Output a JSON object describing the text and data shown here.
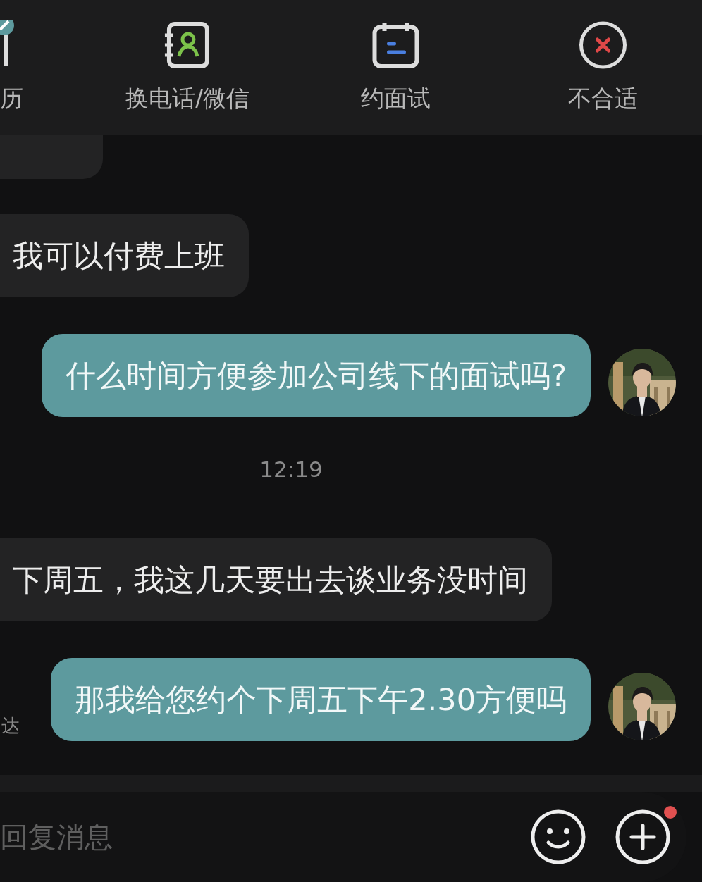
{
  "toolbar": [
    {
      "label": "历",
      "kind": "resume"
    },
    {
      "label": "换电话/微信",
      "kind": "contact"
    },
    {
      "label": "约面试",
      "kind": "interview"
    },
    {
      "label": "不合适",
      "kind": "reject"
    }
  ],
  "messages": [
    {
      "kind": "fragment"
    },
    {
      "kind": "received",
      "text": "我可以付费上班"
    },
    {
      "kind": "sent",
      "text": "什么时间方便参加公司线下的面试吗?"
    },
    {
      "kind": "time",
      "text": "12:19"
    },
    {
      "kind": "received",
      "text": "下周五，我这几天要出去谈业务没时间"
    },
    {
      "kind": "sent",
      "text": "那我给您约个下周五下午2.30方便吗",
      "status": "达"
    }
  ],
  "input": {
    "placeholder": "回复消息",
    "plus_badge": true
  }
}
